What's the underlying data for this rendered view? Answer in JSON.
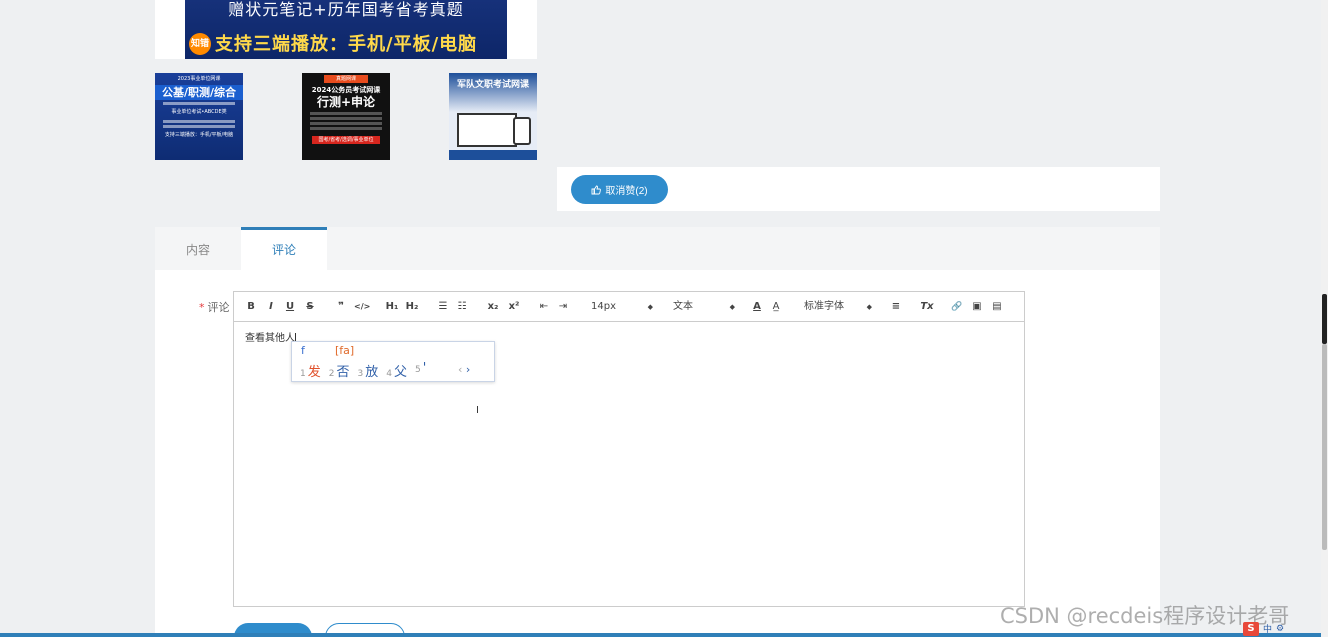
{
  "banner": {
    "line1": "赠状元笔记+历年国考省考真题",
    "line2": "支持三端播放：手机/平板/电脑",
    "badge": "知错"
  },
  "thumbnails": [
    {
      "top_text": "2023事业单位网课",
      "title": "公基/职测/综合",
      "subtitle": "事业单位考试•ABCDE类",
      "footer": "支持三端播放：手机/平板/电脑"
    },
    {
      "tag": "真题网课",
      "top_text": "2024公务员考试网课",
      "title": "行测+申论",
      "footer": "国考/省考/选调/事业单位"
    },
    {
      "title": "军队文职考试网课"
    }
  ],
  "like": {
    "label": "取消赞(2)"
  },
  "tabs": [
    {
      "label": "内容"
    },
    {
      "label": "评论"
    }
  ],
  "form": {
    "label": "评论",
    "required_mark": "*"
  },
  "toolbar": {
    "bold": "B",
    "italic": "I",
    "underline": "U",
    "strike": "S",
    "quote": "❞",
    "code": "</>",
    "h1": "H₁",
    "h2": "H₂",
    "ordered_list": "☰",
    "bullet_list": "☷",
    "subscript": "x₂",
    "superscript": "x²",
    "outdent": "⇤",
    "indent": "⇥",
    "size_value": "14px",
    "header_value": "文本",
    "font_color": "A",
    "background": "A̲",
    "font_value": "标准字体",
    "align": "≡",
    "clean": "Tx",
    "link": "🔗",
    "image": "▣",
    "video": "▤"
  },
  "editor": {
    "text": "查看其他人"
  },
  "ime": {
    "letter": "f",
    "input": "[fa]",
    "candidates": [
      {
        "num": "1",
        "text": "发"
      },
      {
        "num": "2",
        "text": "否"
      },
      {
        "num": "3",
        "text": "放"
      },
      {
        "num": "4",
        "text": "父"
      },
      {
        "num": "5",
        "text": "'"
      }
    ],
    "prev": "‹",
    "next": "›"
  },
  "watermark": "CSDN @recdeis程序设计老哥",
  "tray": {
    "ime_lang": "中",
    "s_icon": "S"
  },
  "colors": {
    "accent": "#2f8ccc",
    "tab_active": "#2f7fb8",
    "required": "#e4393c"
  }
}
